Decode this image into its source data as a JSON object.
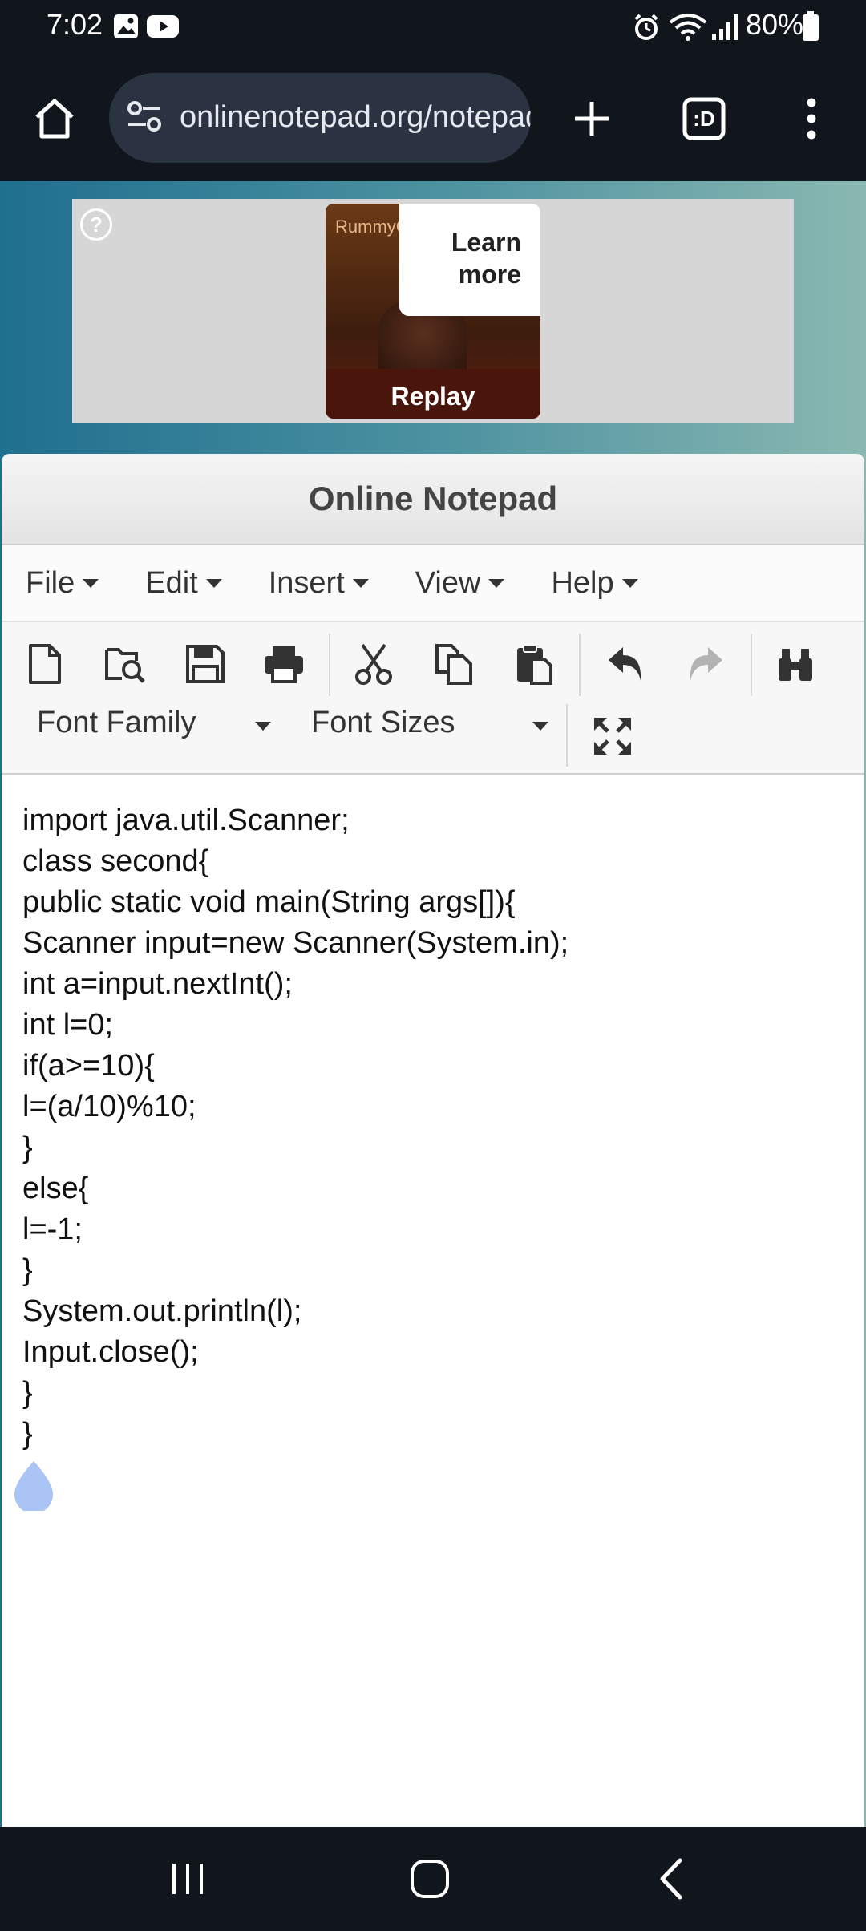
{
  "status_bar": {
    "time": "7:02",
    "battery": "80%",
    "icons": [
      "gallery-icon",
      "youtube-icon",
      "alarm-icon",
      "wifi-icon",
      "signal-icon",
      "battery-icon"
    ]
  },
  "browser": {
    "url": "onlinenotepad.org/notepad",
    "tab_count_label": ":D",
    "icons": [
      "home-icon",
      "site-settings-icon",
      "new-tab-icon",
      "tabs-icon",
      "more-icon"
    ]
  },
  "ad": {
    "brand": "RummyCircle",
    "learn_more": [
      "Learn",
      "more"
    ],
    "replay": "Replay",
    "help": "?"
  },
  "app": {
    "title": "Online Notepad",
    "menu": [
      "File",
      "Edit",
      "Insert",
      "View",
      "Help"
    ],
    "font_family_label": "Font Family",
    "font_sizes_label": "Font Sizes",
    "toolbar_icons": [
      "new-file-icon",
      "open-file-icon",
      "save-icon",
      "print-icon",
      "cut-icon",
      "copy-icon",
      "paste-icon",
      "undo-icon",
      "redo-icon",
      "find-icon",
      "fullscreen-icon"
    ]
  },
  "editor": {
    "lines": [
      "import java.util.Scanner;",
      "class second{",
      "public static void main(String args[]){",
      "Scanner input=new Scanner(System.in);",
      "int a=input.nextInt();",
      "int l=0;",
      "if(a>=10){",
      "l=(a/10)%10;",
      "}",
      "else{",
      "l=-1;",
      "}",
      "System.out.println(l);",
      "Input.close();",
      "}",
      "}"
    ]
  },
  "colors": {
    "system_bg": "#11151c",
    "url_box": "#2b3342",
    "cursor_handle": "#a9c4f5"
  }
}
